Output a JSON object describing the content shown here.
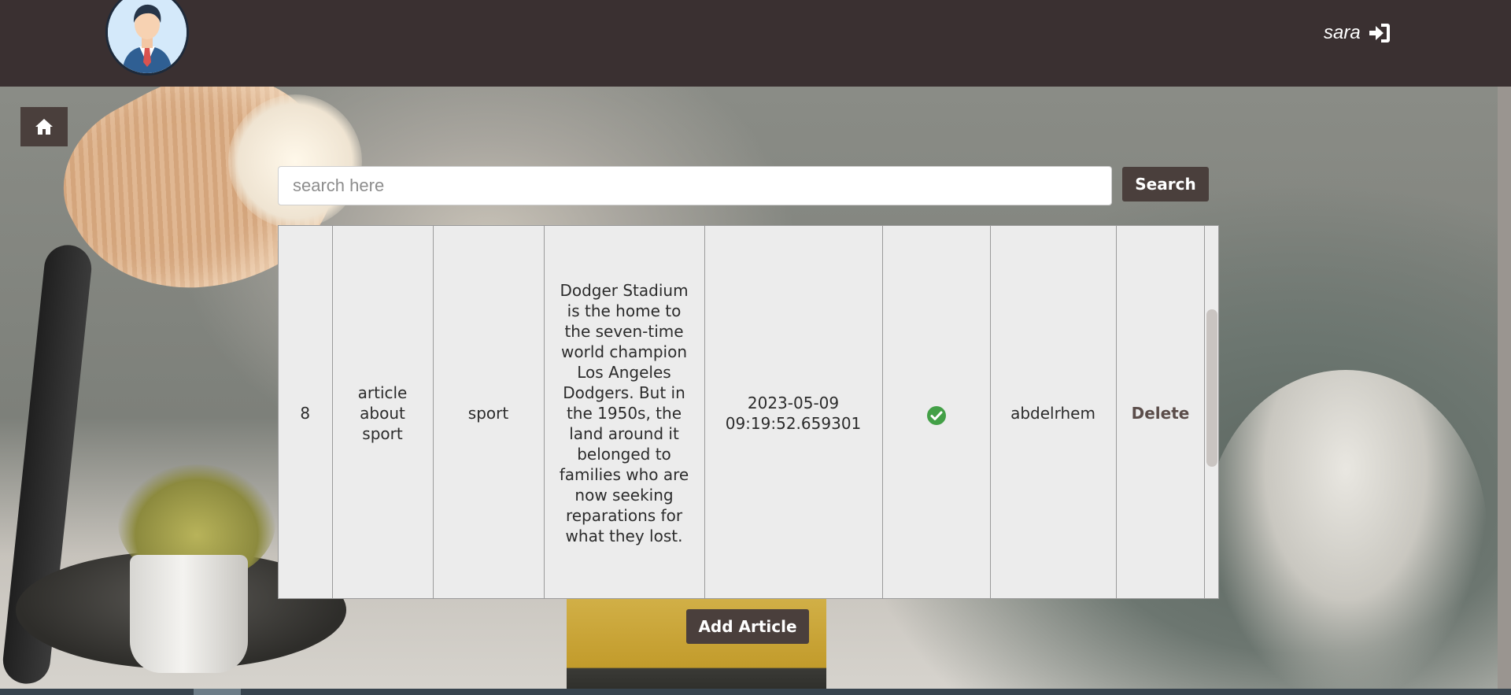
{
  "header": {
    "user_name": "sara",
    "avatar_icon": "businessman-avatar-icon",
    "login_icon": "sign-in-icon",
    "background_color": "#3a3031"
  },
  "home": {
    "icon": "home-icon"
  },
  "search": {
    "placeholder": "search here",
    "value": "",
    "button_label": "Search"
  },
  "articles": {
    "rows": [
      {
        "id": "8",
        "title": "article about sport",
        "category": "sport",
        "content": "Dodger Stadium is the home to the seven-time world champion Los Angeles Dodgers. But in the 1950s, the land around it belonged to families who are now seeking reparations for what they lost.",
        "date": "2023-05-09 09:19:52.659301",
        "published_icon": "check-circle-icon",
        "author": "abdelrhem",
        "delete_label": "Delete"
      }
    ]
  },
  "add_article_label": "Add Article",
  "colors": {
    "button_bg": "#4a3f3c",
    "table_bg": "#ececec",
    "success": "#43a047"
  }
}
